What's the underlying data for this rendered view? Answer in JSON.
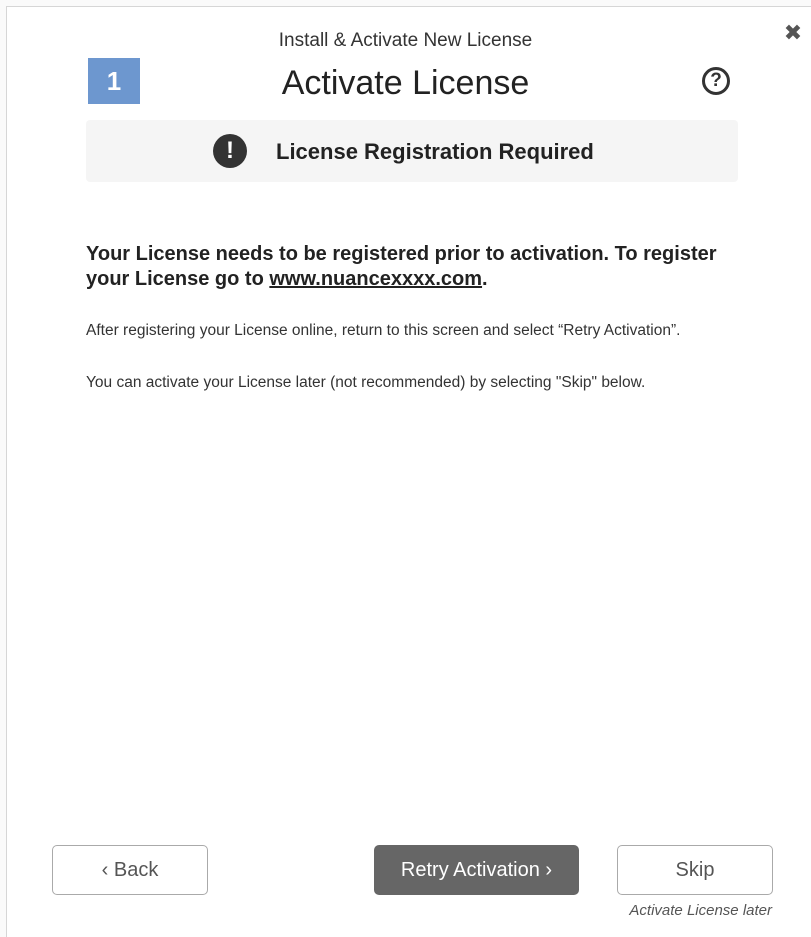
{
  "dialog": {
    "subtitle": "Install & Activate New License",
    "step_number": "1",
    "title": "Activate License",
    "close_glyph": "✖",
    "help_glyph": "?"
  },
  "alert": {
    "icon_glyph": "!",
    "text": "License Registration Required"
  },
  "content": {
    "headline_prefix": "Your License needs to be registered prior to activation. To register your License go to ",
    "headline_link": "www.nuancexxxx.com",
    "headline_suffix": ".",
    "paragraph1": "After registering your License online, return to this screen and select “Retry Activation”.",
    "paragraph2": "You can activate your License later (not recommended) by selecting \"Skip\" below."
  },
  "footer": {
    "back_label": "‹  Back",
    "retry_label": "Retry Activation ›",
    "skip_label": "Skip",
    "skip_note": "Activate License later"
  },
  "colors": {
    "step_badge": "#6d97cf",
    "primary_button": "#666666",
    "alert_background": "#f5f5f5"
  }
}
